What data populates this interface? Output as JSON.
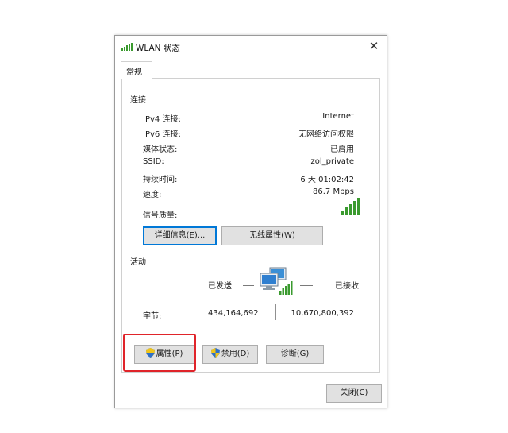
{
  "window": {
    "title": "WLAN 状态",
    "close_symbol": "✕"
  },
  "tabs": [
    {
      "label": "常规"
    }
  ],
  "connection": {
    "group_label": "连接",
    "rows": [
      {
        "label": "IPv4 连接:",
        "value": "Internet"
      },
      {
        "label": "IPv6 连接:",
        "value": "无网络访问权限"
      },
      {
        "label": "媒体状态:",
        "value": "已启用"
      },
      {
        "label": "SSID:",
        "value": "zol_private"
      },
      {
        "label": "持续时间:",
        "value": "6 天 01:02:42"
      },
      {
        "label": "速度:",
        "value": "86.7 Mbps"
      }
    ],
    "signal_label": "信号质量:",
    "signal_bars": 5,
    "details_button": "详细信息(E)...",
    "wireless_props_button": "无线属性(W)"
  },
  "activity": {
    "group_label": "活动",
    "sent_label": "已发送",
    "received_label": "已接收",
    "bytes_label": "字节:",
    "bytes_sent": "434,164,692",
    "bytes_received": "10,670,800,392"
  },
  "buttons": {
    "properties": "属性(P)",
    "disable": "禁用(D)",
    "diagnose": "诊断(G)",
    "close": "关闭(C)"
  },
  "colors": {
    "signal": "#3a9a2e",
    "highlight": "#e0242a",
    "focus": "#0078d7"
  }
}
